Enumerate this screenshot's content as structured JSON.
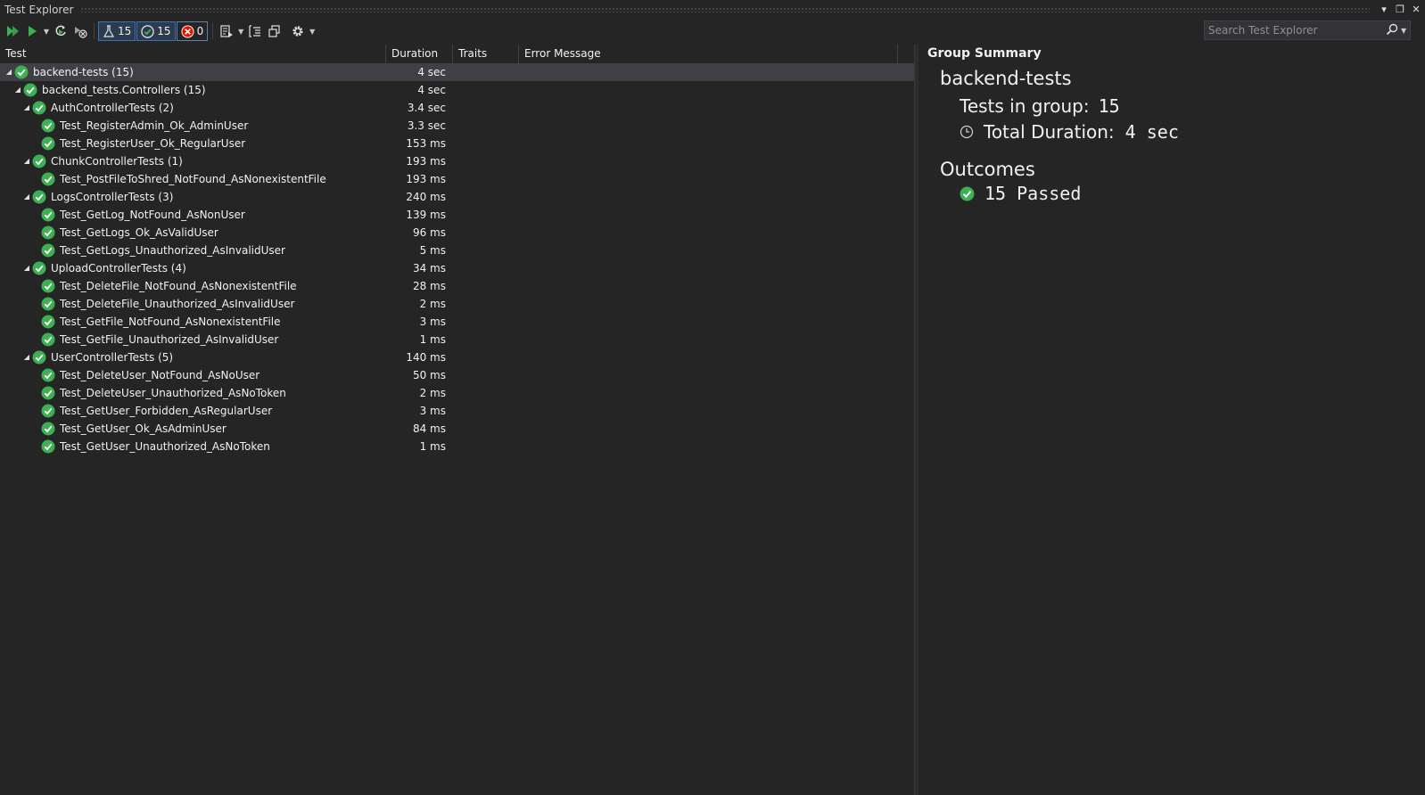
{
  "window": {
    "title": "Test Explorer"
  },
  "toolbar": {
    "counters": {
      "total": "15",
      "passed": "15",
      "failed": "0"
    },
    "search_placeholder": "Search Test Explorer"
  },
  "columns": {
    "test": "Test",
    "duration": "Duration",
    "traits": "Traits",
    "error": "Error Message"
  },
  "tree": [
    {
      "label": "backend-tests (15)",
      "duration": "4 sec",
      "level": 0,
      "expandable": true,
      "selected": true
    },
    {
      "label": "backend_tests.Controllers (15)",
      "duration": "4 sec",
      "level": 1,
      "expandable": true
    },
    {
      "label": "AuthControllerTests (2)",
      "duration": "3.4 sec",
      "level": 2,
      "expandable": true
    },
    {
      "label": "Test_RegisterAdmin_Ok_AdminUser",
      "duration": "3.3 sec",
      "level": 3
    },
    {
      "label": "Test_RegisterUser_Ok_RegularUser",
      "duration": "153 ms",
      "level": 3
    },
    {
      "label": "ChunkControllerTests (1)",
      "duration": "193 ms",
      "level": 2,
      "expandable": true
    },
    {
      "label": "Test_PostFileToShred_NotFound_AsNonexistentFile",
      "duration": "193 ms",
      "level": 3
    },
    {
      "label": "LogsControllerTests (3)",
      "duration": "240 ms",
      "level": 2,
      "expandable": true
    },
    {
      "label": "Test_GetLog_NotFound_AsNonUser",
      "duration": "139 ms",
      "level": 3
    },
    {
      "label": "Test_GetLogs_Ok_AsValidUser",
      "duration": "96 ms",
      "level": 3
    },
    {
      "label": "Test_GetLogs_Unauthorized_AsInvalidUser",
      "duration": "5 ms",
      "level": 3
    },
    {
      "label": "UploadControllerTests (4)",
      "duration": "34 ms",
      "level": 2,
      "expandable": true
    },
    {
      "label": "Test_DeleteFile_NotFound_AsNonexistentFile",
      "duration": "28 ms",
      "level": 3
    },
    {
      "label": "Test_DeleteFile_Unauthorized_AsInvalidUser",
      "duration": "2 ms",
      "level": 3
    },
    {
      "label": "Test_GetFile_NotFound_AsNonexistentFile",
      "duration": "3 ms",
      "level": 3
    },
    {
      "label": "Test_GetFile_Unauthorized_AsInvalidUser",
      "duration": "1 ms",
      "level": 3
    },
    {
      "label": "UserControllerTests (5)",
      "duration": "140 ms",
      "level": 2,
      "expandable": true
    },
    {
      "label": "Test_DeleteUser_NotFound_AsNoUser",
      "duration": "50 ms",
      "level": 3
    },
    {
      "label": "Test_DeleteUser_Unauthorized_AsNoToken",
      "duration": "2 ms",
      "level": 3
    },
    {
      "label": "Test_GetUser_Forbidden_AsRegularUser",
      "duration": "3 ms",
      "level": 3
    },
    {
      "label": "Test_GetUser_Ok_AsAdminUser",
      "duration": "84 ms",
      "level": 3
    },
    {
      "label": "Test_GetUser_Unauthorized_AsNoToken",
      "duration": "1 ms",
      "level": 3
    }
  ],
  "summary": {
    "heading": "Group Summary",
    "group_name": "backend-tests",
    "tests_label": "Tests in group:",
    "tests_value": "15",
    "duration_label": "Total Duration:",
    "duration_value": "4 sec",
    "outcomes_heading": "Outcomes",
    "passed_text": "15 Passed"
  },
  "colors": {
    "pass": "#3eb054",
    "fail": "#e51400",
    "background": "#252526",
    "selection": "#3f3f46"
  }
}
